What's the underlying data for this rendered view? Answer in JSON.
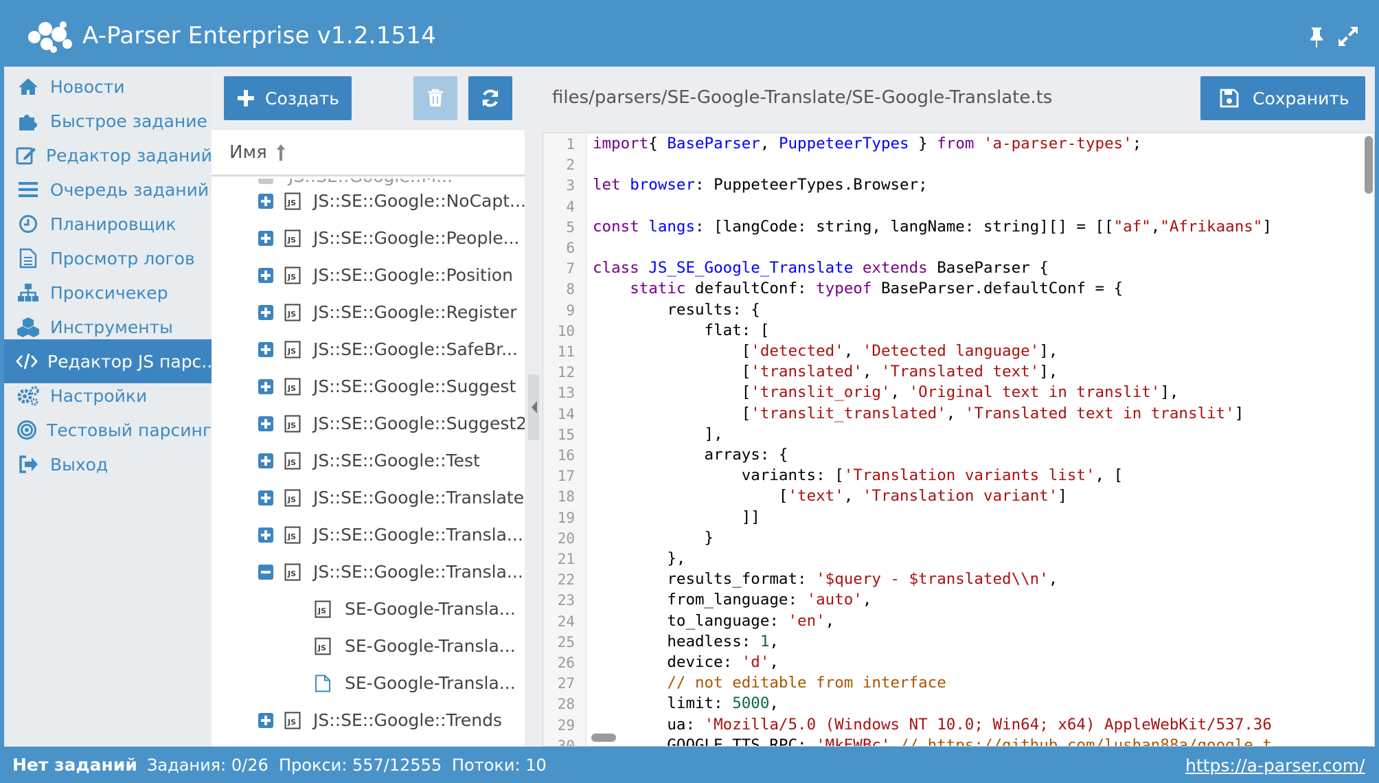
{
  "window": {
    "title": "A-Parser Enterprise v1.2.1514",
    "icons": [
      "logo-icon",
      "pin-icon",
      "expand-icon"
    ]
  },
  "colors": {
    "accent": "#4a93c9",
    "button": "#3d85c0",
    "button_disabled": "#a6c8e2",
    "sidebar_bg": "#e9ecef",
    "nav_text": "#3d8ac3"
  },
  "sidebar": {
    "items": [
      {
        "label": "Новости",
        "icon": "home-icon"
      },
      {
        "label": "Быстрое задание",
        "icon": "puzzle-icon"
      },
      {
        "label": "Редактор заданий",
        "icon": "edit-icon"
      },
      {
        "label": "Очередь заданий",
        "icon": "list-icon"
      },
      {
        "label": "Планировщик",
        "icon": "clock-icon"
      },
      {
        "label": "Просмотр логов",
        "icon": "document-icon"
      },
      {
        "label": "Проксичекер",
        "icon": "sitemap-icon"
      },
      {
        "label": "Инструменты",
        "icon": "cubes-icon"
      },
      {
        "label": "Редактор JS парс...",
        "icon": "code-icon",
        "active": true
      },
      {
        "label": "Настройки",
        "icon": "gears-icon"
      },
      {
        "label": "Тестовый парсинг",
        "icon": "target-icon"
      },
      {
        "label": "Выход",
        "icon": "sign-out-icon"
      }
    ]
  },
  "filepanel": {
    "create_label": "Создать",
    "column_name": "Имя",
    "tree": [
      {
        "label": "JS::SE::Google::NoCapt...",
        "toggle": "plus",
        "type": "js"
      },
      {
        "label": "JS::SE::Google::People...",
        "toggle": "plus",
        "type": "js"
      },
      {
        "label": "JS::SE::Google::Position",
        "toggle": "plus",
        "type": "js"
      },
      {
        "label": "JS::SE::Google::Register",
        "toggle": "plus",
        "type": "js"
      },
      {
        "label": "JS::SE::Google::SafeBr...",
        "toggle": "plus",
        "type": "js"
      },
      {
        "label": "JS::SE::Google::Suggest",
        "toggle": "plus",
        "type": "js"
      },
      {
        "label": "JS::SE::Google::Suggest2",
        "toggle": "plus",
        "type": "js"
      },
      {
        "label": "JS::SE::Google::Test",
        "toggle": "plus",
        "type": "js"
      },
      {
        "label": "JS::SE::Google::Translate",
        "toggle": "plus",
        "type": "js"
      },
      {
        "label": "JS::SE::Google::Transla...",
        "toggle": "plus",
        "type": "js"
      },
      {
        "label": "JS::SE::Google::Transla...",
        "toggle": "minus",
        "type": "js"
      },
      {
        "label": "SE-Google-Transla...",
        "toggle": "none",
        "type": "js"
      },
      {
        "label": "SE-Google-Transla...",
        "toggle": "none",
        "type": "js"
      },
      {
        "label": "SE-Google-Transla...",
        "toggle": "none",
        "type": "file"
      },
      {
        "label": "JS::SE::Google::Trends",
        "toggle": "plus",
        "type": "js"
      }
    ]
  },
  "editor": {
    "file_path": "files/parsers/SE-Google-Translate/SE-Google-Translate.ts",
    "save_label": "Сохранить",
    "lines": [
      [
        [
          "kw",
          "import"
        ],
        [
          "",
          "{ "
        ],
        [
          "def",
          "BaseParser"
        ],
        [
          "",
          ", "
        ],
        [
          "def",
          "PuppeteerTypes"
        ],
        [
          "",
          " } "
        ],
        [
          "kw",
          "from"
        ],
        [
          "",
          " "
        ],
        [
          "str",
          "'a-parser-types'"
        ],
        [
          "",
          ";"
        ]
      ],
      [],
      [
        [
          "kw",
          "let"
        ],
        [
          "",
          " "
        ],
        [
          "def",
          "browser"
        ],
        [
          "",
          ": PuppeteerTypes.Browser;"
        ]
      ],
      [],
      [
        [
          "kw",
          "const"
        ],
        [
          "",
          " "
        ],
        [
          "def",
          "langs"
        ],
        [
          "",
          ": [langCode: string, langName: string][] = [["
        ],
        [
          "str",
          "\"af\""
        ],
        [
          "",
          ","
        ],
        [
          "str",
          "\"Afrikaans\""
        ],
        [
          "",
          "]"
        ]
      ],
      [],
      [
        [
          "kw",
          "class"
        ],
        [
          "",
          " "
        ],
        [
          "def",
          "JS_SE_Google_Translate"
        ],
        [
          "",
          " "
        ],
        [
          "kw",
          "extends"
        ],
        [
          "",
          " BaseParser {"
        ]
      ],
      [
        [
          "",
          "    "
        ],
        [
          "kw",
          "static"
        ],
        [
          "",
          " defaultConf: "
        ],
        [
          "kw",
          "typeof"
        ],
        [
          "",
          " BaseParser.defaultConf = {"
        ]
      ],
      [
        [
          "",
          "        results: {"
        ]
      ],
      [
        [
          "",
          "            flat: ["
        ]
      ],
      [
        [
          "",
          "                ["
        ],
        [
          "str",
          "'detected'"
        ],
        [
          "",
          ", "
        ],
        [
          "str",
          "'Detected language'"
        ],
        [
          "",
          "],"
        ]
      ],
      [
        [
          "",
          "                ["
        ],
        [
          "str",
          "'translated'"
        ],
        [
          "",
          ", "
        ],
        [
          "str",
          "'Translated text'"
        ],
        [
          "",
          "],"
        ]
      ],
      [
        [
          "",
          "                ["
        ],
        [
          "str",
          "'translit_orig'"
        ],
        [
          "",
          ", "
        ],
        [
          "str",
          "'Original text in translit'"
        ],
        [
          "",
          "],"
        ]
      ],
      [
        [
          "",
          "                ["
        ],
        [
          "str",
          "'translit_translated'"
        ],
        [
          "",
          ", "
        ],
        [
          "str",
          "'Translated text in translit'"
        ],
        [
          "",
          "]"
        ]
      ],
      [
        [
          "",
          "            ],"
        ]
      ],
      [
        [
          "",
          "            arrays: {"
        ]
      ],
      [
        [
          "",
          "                variants: ["
        ],
        [
          "str",
          "'Translation variants list'"
        ],
        [
          "",
          ", ["
        ]
      ],
      [
        [
          "",
          "                    ["
        ],
        [
          "str",
          "'text'"
        ],
        [
          "",
          ", "
        ],
        [
          "str",
          "'Translation variant'"
        ],
        [
          "",
          "]"
        ]
      ],
      [
        [
          "",
          "                ]]"
        ]
      ],
      [
        [
          "",
          "            }"
        ]
      ],
      [
        [
          "",
          "        },"
        ]
      ],
      [
        [
          "",
          "        results_format: "
        ],
        [
          "str",
          "'$query - $translated\\\\n'"
        ],
        [
          "",
          ","
        ]
      ],
      [
        [
          "",
          "        from_language: "
        ],
        [
          "str",
          "'auto'"
        ],
        [
          "",
          ","
        ]
      ],
      [
        [
          "",
          "        to_language: "
        ],
        [
          "str",
          "'en'"
        ],
        [
          "",
          ","
        ]
      ],
      [
        [
          "",
          "        headless: "
        ],
        [
          "num",
          "1"
        ],
        [
          "",
          ","
        ]
      ],
      [
        [
          "",
          "        device: "
        ],
        [
          "str",
          "'d'"
        ],
        [
          "",
          ","
        ]
      ],
      [
        [
          "",
          "        "
        ],
        [
          "cmt",
          "// not editable from interface"
        ]
      ],
      [
        [
          "",
          "        limit: "
        ],
        [
          "num",
          "5000"
        ],
        [
          "",
          ","
        ]
      ],
      [
        [
          "",
          "        ua: "
        ],
        [
          "str",
          "'Mozilla/5.0 (Windows NT 10.0; Win64; x64) AppleWebKit/537.36"
        ]
      ],
      [
        [
          "",
          "        GOOGLE_TTS_RPC: "
        ],
        [
          "str",
          "'MkEWBc'"
        ],
        [
          "",
          " "
        ],
        [
          "cmt",
          "// https://github.com/lushan88a/google_t"
        ]
      ]
    ]
  },
  "status": {
    "main": "Нет заданий",
    "tasks": "Задания: 0/26",
    "proxy": "Прокси: 557/12555",
    "threads": "Потоки: 10",
    "link": "https://a-parser.com/"
  }
}
